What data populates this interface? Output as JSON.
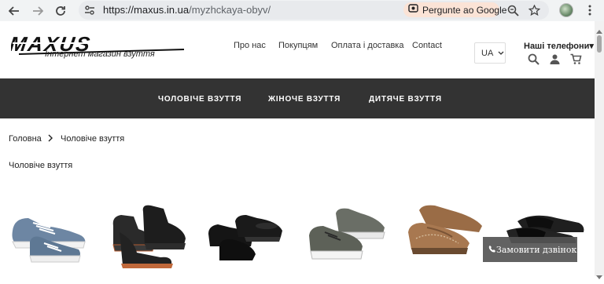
{
  "browser": {
    "url_host": "https://maxus.in.ua",
    "url_path": "/myzhckaya-obyv/",
    "lens_label": "Pergunte ao Google",
    "icons": [
      "back-arrow-icon",
      "forward-arrow-icon",
      "reload-icon",
      "site-info-icon",
      "google-lens-icon",
      "zoom-icon",
      "bookmark-star-icon",
      "profile-avatar",
      "menu-dots-icon"
    ]
  },
  "header": {
    "logo_text": "MAXUS",
    "tagline": "Інтернет магазин взуття",
    "nav": [
      "Про нас",
      "Покупцям",
      "Оплата і доставка",
      "Contact"
    ],
    "language": "UA",
    "phones_label": "Наші телефони",
    "icons": [
      "search-icon",
      "user-icon",
      "cart-icon"
    ]
  },
  "categories": [
    "ЧОЛОВІЧЕ ВЗУТТЯ",
    "ЖІНОЧЕ ВЗУТТЯ",
    "ДИТЯЧЕ ВЗУТТЯ"
  ],
  "breadcrumb": {
    "home": "Головна",
    "current": "Чоловіче взуття"
  },
  "page_title": "Чоловіче взуття",
  "products": [
    {
      "kind": "blue suede sneakers",
      "color": "#6d86a3"
    },
    {
      "kind": "black hiking boots",
      "color": "#2a2a2a"
    },
    {
      "kind": "black leather shoes",
      "color": "#151515"
    },
    {
      "kind": "grey knit sneakers",
      "color": "#5d6158"
    },
    {
      "kind": "brown moccasins",
      "color": "#a87850"
    },
    {
      "kind": "black sandals",
      "color": "#1f1f1f"
    }
  ],
  "call_button": "Замовити дзвінок",
  "colors": {
    "category_bar": "#333333",
    "browser_chrome": "#f1f3f4",
    "lens_pill": "#fbe3d6"
  }
}
